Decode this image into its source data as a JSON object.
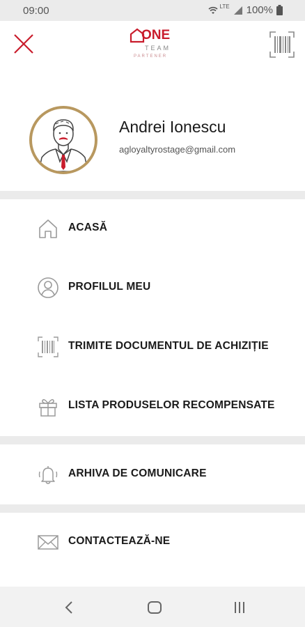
{
  "status_bar": {
    "time": "09:00",
    "network": "LTE",
    "battery": "100%"
  },
  "header": {
    "logo_one": "ONE",
    "logo_team": "TEAM",
    "logo_partener": "PARTENER",
    "close_icon": "close-icon",
    "barcode_icon": "barcode-icon",
    "brand_color": "#c91c2c"
  },
  "profile": {
    "name": "Andrei Ionescu",
    "email": "agloyaltyrostage@gmail.com",
    "avatar_ring_color": "#b8985f"
  },
  "menu": {
    "items": [
      {
        "label": "ACASĂ",
        "icon": "home-icon"
      },
      {
        "label": "PROFILUL MEU",
        "icon": "user-icon"
      },
      {
        "label": "TRIMITE DOCUMENTUL DE ACHIZIȚIE",
        "icon": "barcode-icon"
      },
      {
        "label": "LISTA PRODUSELOR RECOMPENSATE",
        "icon": "gift-icon"
      },
      {
        "label": "ARHIVA DE COMUNICARE",
        "icon": "bell-icon"
      },
      {
        "label": "CONTACTEAZĂ-NE",
        "icon": "mail-icon"
      }
    ]
  },
  "nav_bar": {
    "back_icon": "back-icon",
    "home_icon": "home-button-icon",
    "recents_icon": "recents-icon"
  }
}
